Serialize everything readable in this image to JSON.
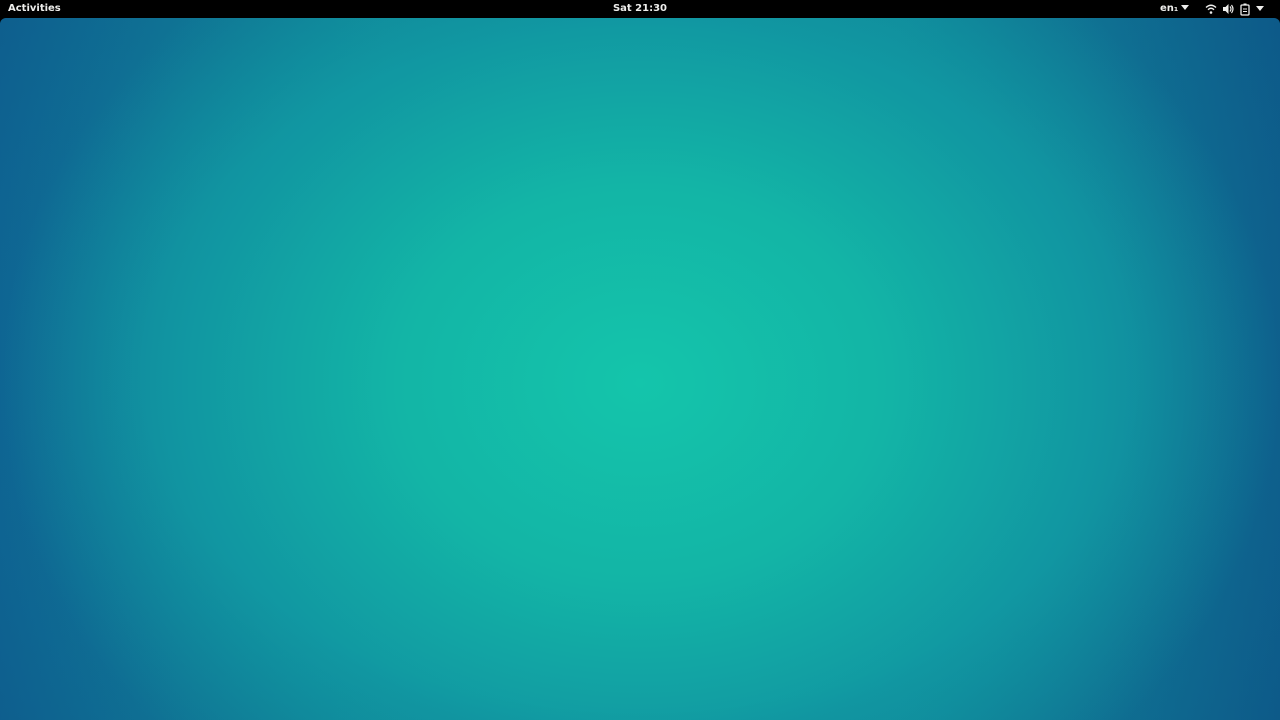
{
  "top_bar": {
    "activities_label": "Activities",
    "clock_label": "Sat 21:30",
    "keyboard_layout": "en₁",
    "tray_icons": [
      "wifi-icon",
      "volume-icon",
      "battery-icon",
      "chevron-down-icon"
    ]
  },
  "desktop": {
    "accent_color": "#14c5ab",
    "edge_color": "#0f6b97"
  }
}
